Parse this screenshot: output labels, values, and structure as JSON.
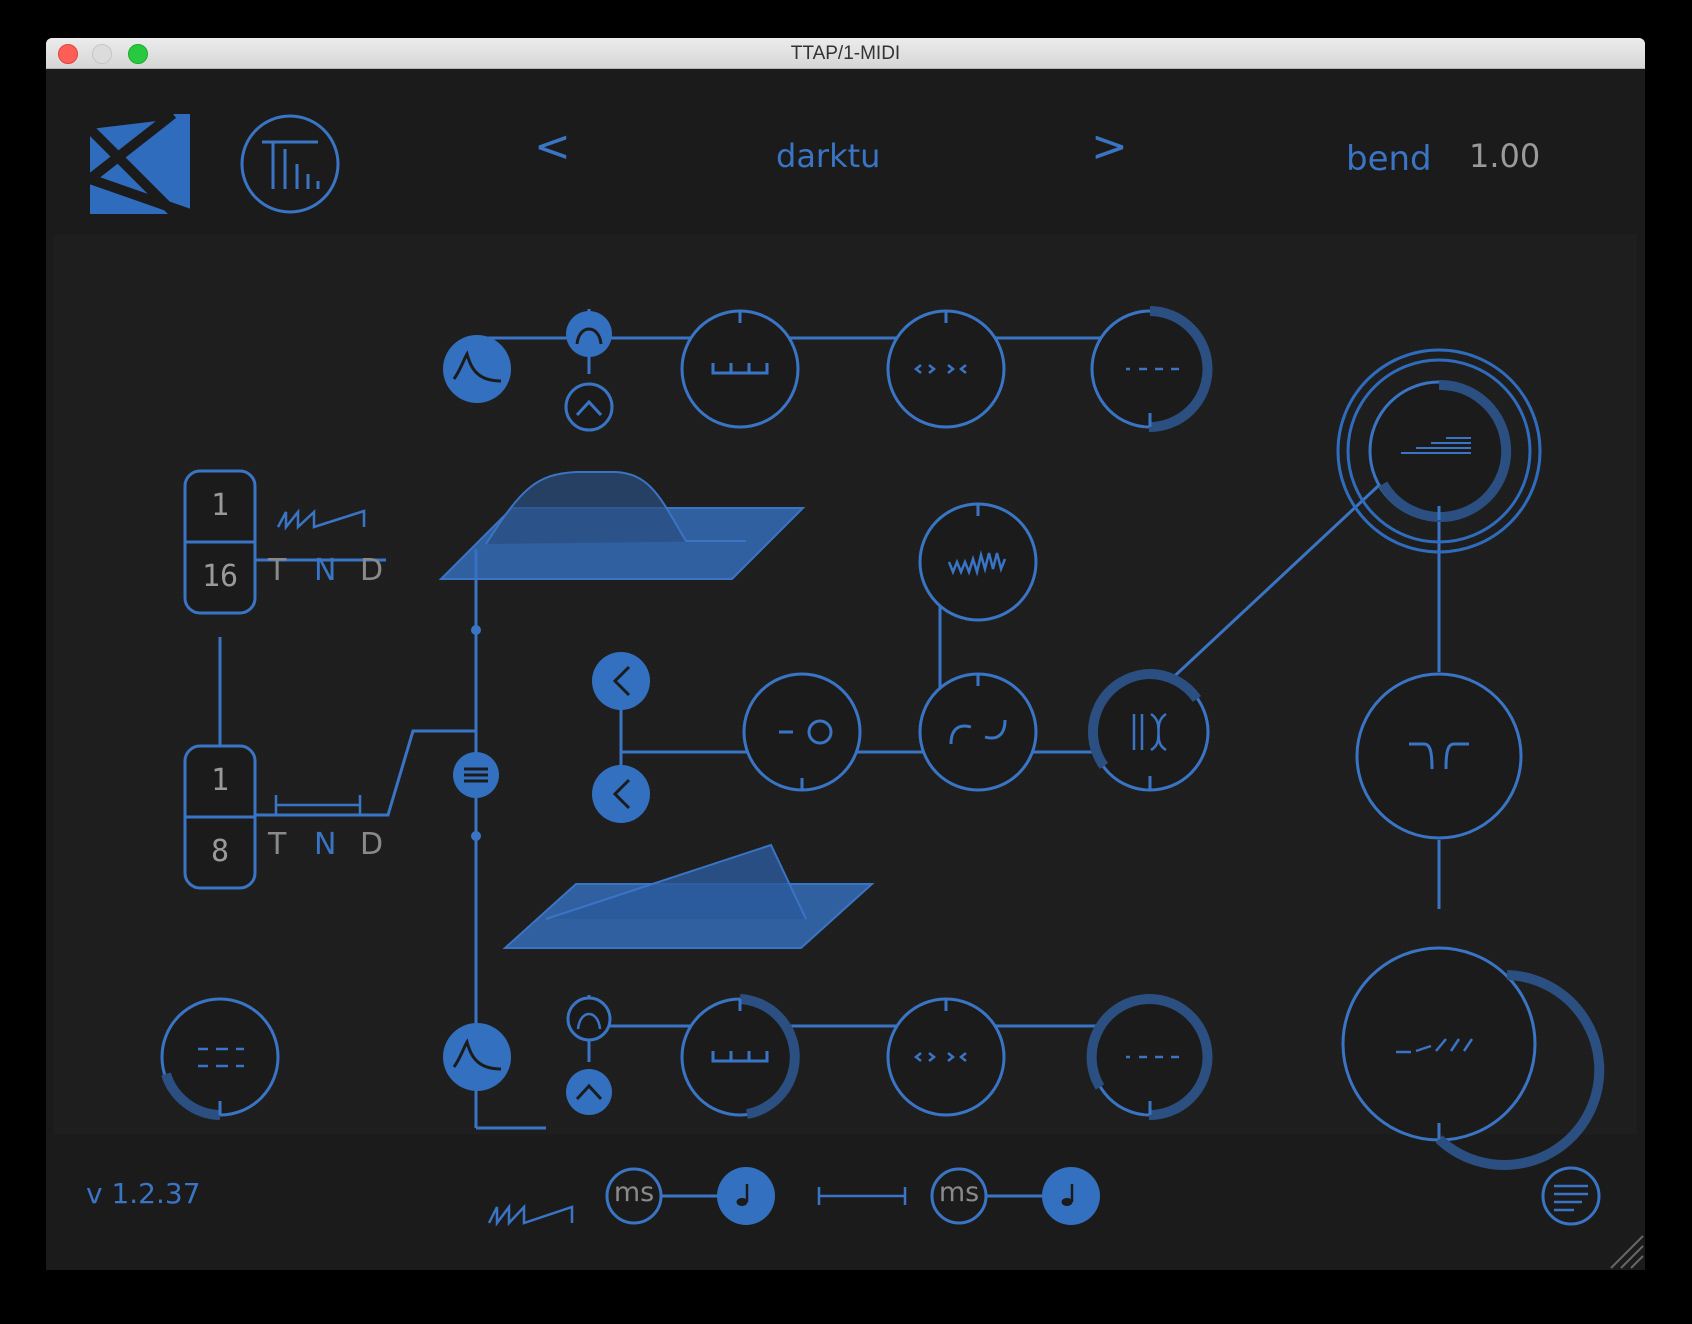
{
  "window": {
    "title": "TTAP/1-MIDI"
  },
  "header": {
    "prev_label": "<",
    "preset_name": "darktu",
    "next_label": ">",
    "param_name": "bend",
    "param_value": "1.00"
  },
  "sequencer": {
    "top": {
      "numerator": "1",
      "denominator": "16",
      "modes": [
        "T",
        "N",
        "D"
      ]
    },
    "bottom": {
      "numerator": "1",
      "denominator": "8",
      "modes": [
        "T",
        "N",
        "D"
      ]
    }
  },
  "footer": {
    "version": "v 1.2.37",
    "toggle_labels": [
      "ms",
      "ms"
    ]
  },
  "colors": {
    "accent": "#3a74c4",
    "accent_fill": "#3470c0",
    "background": "#1b1b1b",
    "text_grey": "#9a9a9a"
  },
  "icons": [
    "logo-icon",
    "hub-icon",
    "envelope-icon",
    "wave-icon",
    "menu-icon",
    "note-icon",
    "tap-icon",
    "sawtooth-icon",
    "interval-icon",
    "filter-icon",
    "drift-icon",
    "gate-icon"
  ]
}
